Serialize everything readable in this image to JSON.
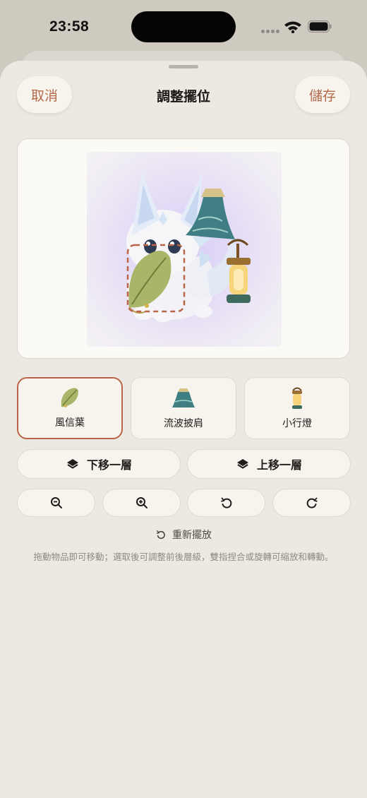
{
  "status": {
    "time": "23:58"
  },
  "header": {
    "cancel_label": "取消",
    "title": "調整擺位",
    "save_label": "儲存"
  },
  "items": [
    {
      "label": "風信葉",
      "icon": "leaf-icon",
      "selected": true
    },
    {
      "label": "流波披肩",
      "icon": "cape-icon",
      "selected": false
    },
    {
      "label": "小行燈",
      "icon": "lantern-icon",
      "selected": false
    }
  ],
  "layer_controls": {
    "down_label": "下移一層",
    "up_label": "上移一層"
  },
  "transform_controls": [
    "zoom-out-icon",
    "zoom-in-icon",
    "rotate-left-icon",
    "rotate-right-icon"
  ],
  "reset_label": "重新擺放",
  "hint": "拖動物品即可移動；選取後可調整前後層級，雙指捏合或旋轉可縮放和轉動。",
  "colors": {
    "accent": "#b4684a",
    "sheet_bg": "#ece9e2",
    "card_bg": "#f7f4ee"
  }
}
